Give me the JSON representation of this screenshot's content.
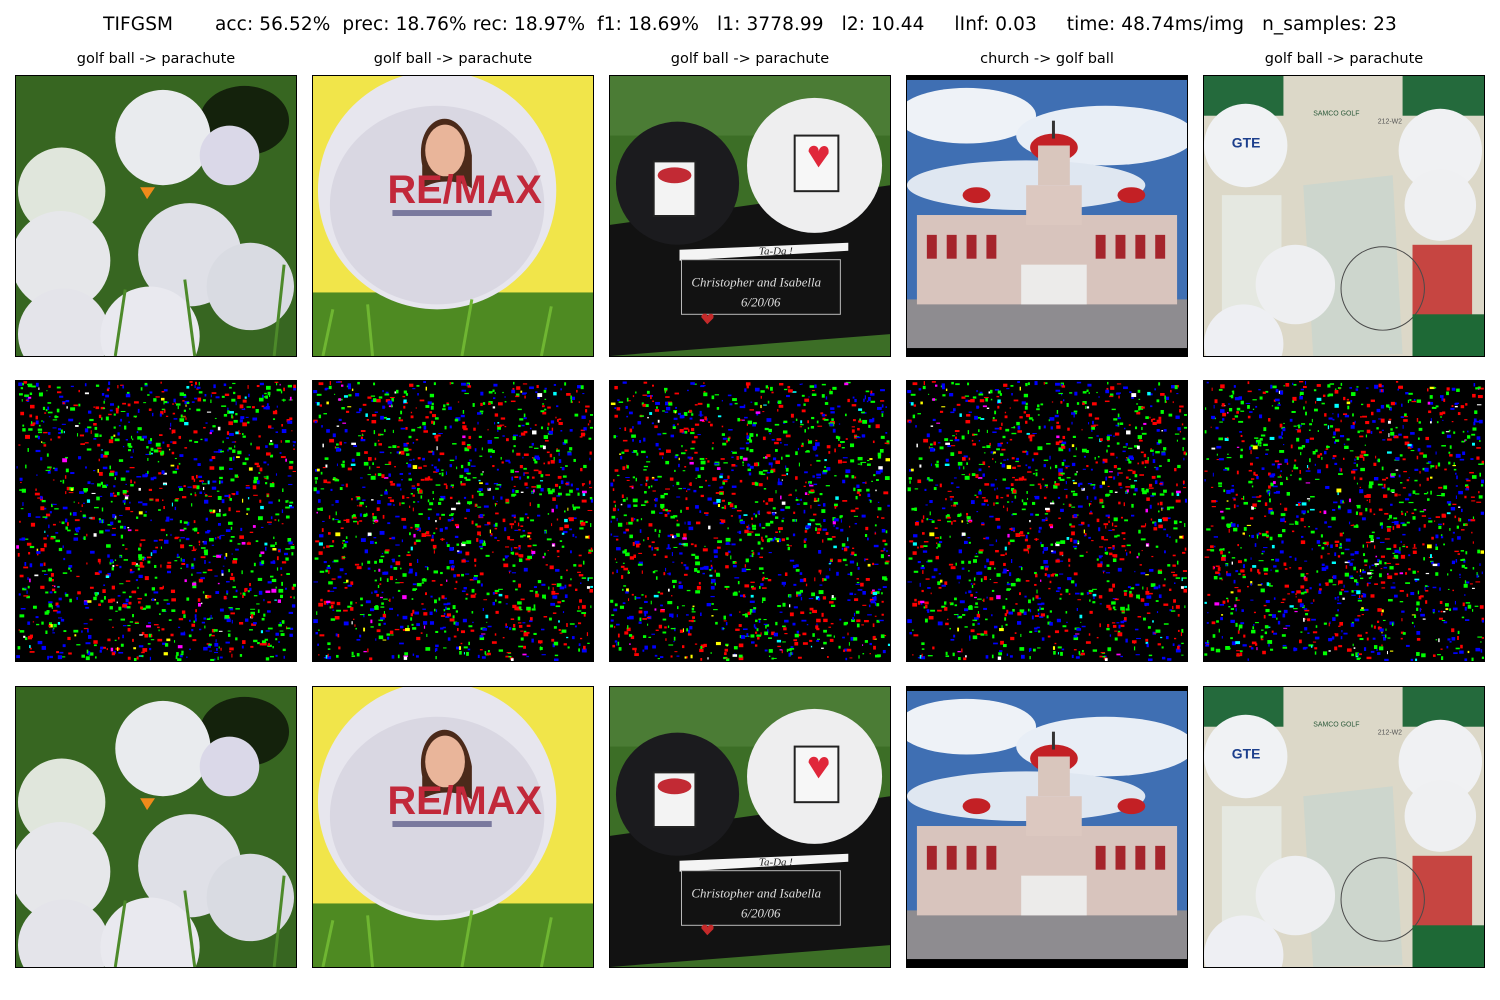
{
  "figure": {
    "suptitle": "TIFGSM       acc: 56.52%  prec: 18.76% rec: 18.97%  f1: 18.69%   l1: 3778.99   l2: 10.44     lInf: 0.03     time: 48.74ms/img   n_samples: 23"
  },
  "columns": [
    {
      "title": "golf ball -> parachute"
    },
    {
      "title": "golf ball -> parachute"
    },
    {
      "title": "golf ball -> parachute"
    },
    {
      "title": "church -> golf ball"
    },
    {
      "title": "golf ball -> parachute"
    }
  ],
  "photo_text": {
    "remax_logo": "RE/MAX",
    "tee_text": "Ta-Da !",
    "plaque_line1": "Christopher and Isabella",
    "plaque_line2": "6/20/06",
    "gte_logo": "GTE",
    "box_label": "212-W2",
    "samco_logo": "SAMCO GOLF"
  },
  "noise_colors": [
    "#00ff00",
    "#ff0000",
    "#0000ff",
    "#ff00ff",
    "#00ffff",
    "#ffff00",
    "#ffffff"
  ]
}
